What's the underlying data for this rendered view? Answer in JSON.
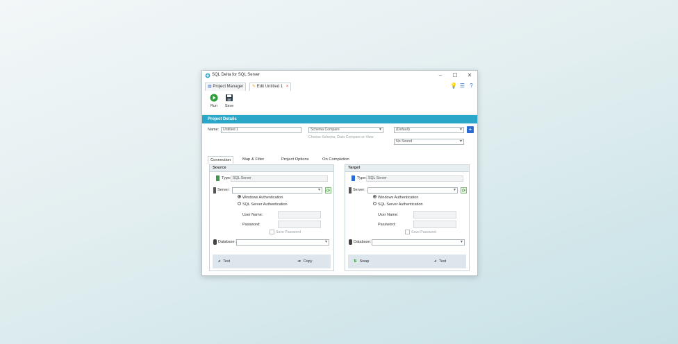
{
  "window": {
    "title": "SQL Delta for SQL Server",
    "controls": [
      "–",
      "☐",
      "✕"
    ]
  },
  "tabs": {
    "project_manager": "Project Manager",
    "edit": "Edit Untitled 1",
    "close": "×"
  },
  "toolbar": {
    "run": "Run",
    "save": "Save"
  },
  "banner": "Project Details",
  "details": {
    "name_label": "Name:",
    "name_value": "Untitled 1",
    "compare_type": "Schema Compare",
    "compare_hint": "Choose Schema, Data Compare or View",
    "default_value": "(Default)",
    "no_sound": "No Sound",
    "add": "+"
  },
  "conn_tabs": [
    "Connection",
    "Map & Filter",
    "Project Options",
    "On Completion"
  ],
  "source": {
    "title": "Source",
    "type_label": "Type:",
    "type_value": "SQL Server",
    "server_label": "Server:",
    "server_value": "",
    "win_auth": "Windows Authentication",
    "sql_auth": "SQL Server Authentication",
    "user_label": "User Name:",
    "password_label": "Password:",
    "save_password": "Save Password",
    "database_label": "Database:",
    "test": "Test",
    "copy": "Copy"
  },
  "target": {
    "title": "Target",
    "type_label": "Type:",
    "type_value": "SQL Server",
    "server_label": "Server:",
    "server_value": "",
    "win_auth": "Windows Authentication",
    "sql_auth": "SQL Server Authentication",
    "user_label": "User Name:",
    "password_label": "Password:",
    "save_password": "Save Password",
    "database_label": "Database:",
    "swap": "Swap",
    "test": "Test"
  },
  "colors": {
    "accent": "#2aa6c8",
    "run_icon": "#2e9d3a",
    "plus": "#2a6bd1"
  }
}
